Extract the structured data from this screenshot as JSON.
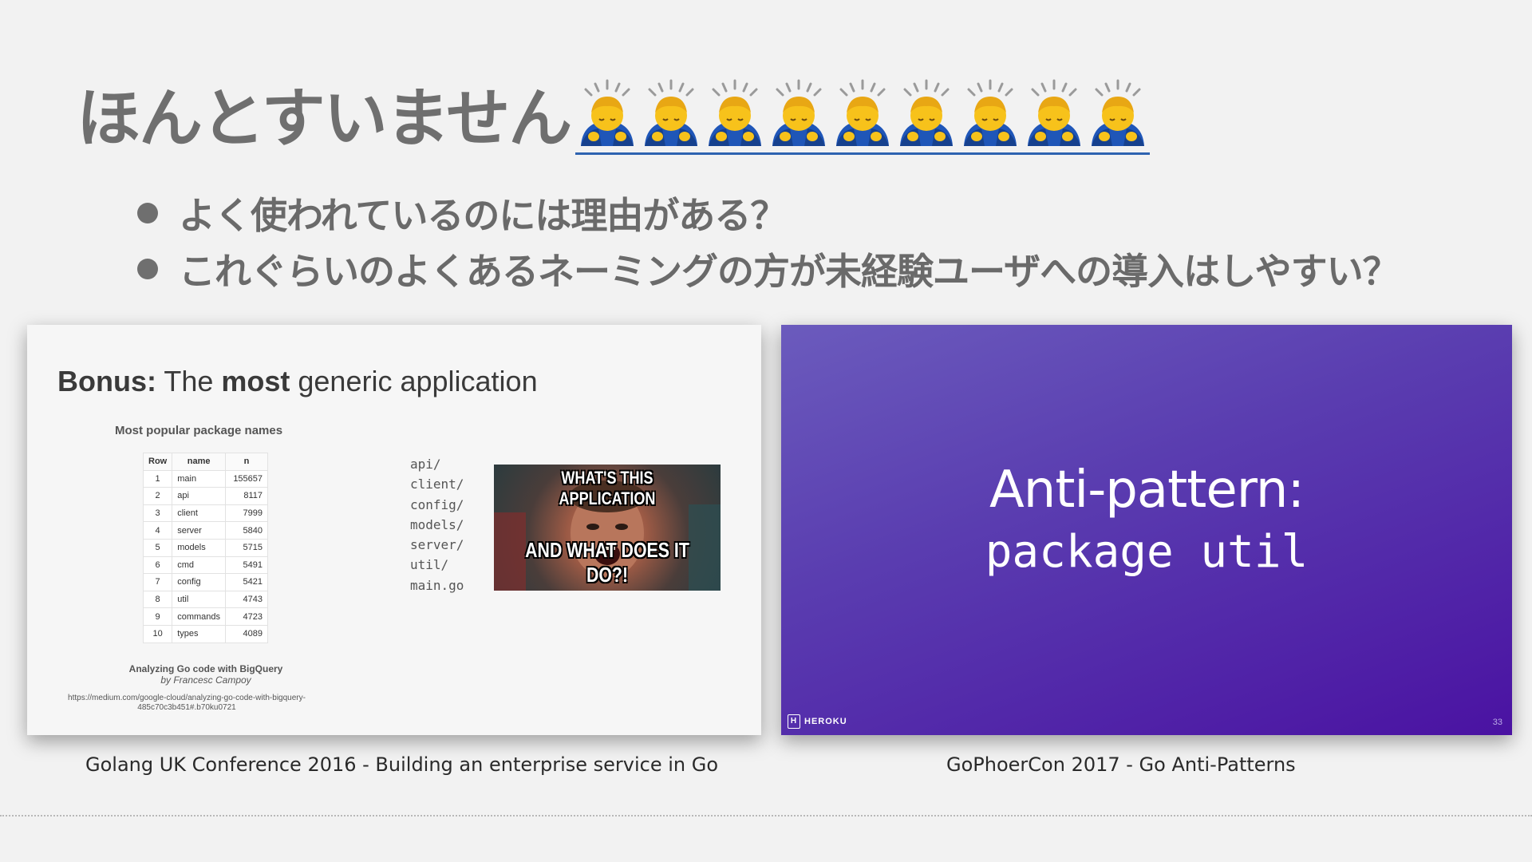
{
  "title": {
    "text": "ほんとすいません",
    "emoji_count": 9,
    "emoji_name": "person-bowing"
  },
  "bullets": [
    "よく使われているのには理由がある？",
    "これぐらいのよくあるネーミングの方が未経験ユーザへの導入はしやすい？"
  ],
  "left_slide": {
    "title_bold1": "Bonus:",
    "title_mid1": " The ",
    "title_bold2": "most",
    "title_mid2": " generic application",
    "subtitle": "Most popular package names",
    "table": {
      "headers": [
        "Row",
        "name",
        "n"
      ],
      "rows": [
        [
          "1",
          "main",
          "155657"
        ],
        [
          "2",
          "api",
          "8117"
        ],
        [
          "3",
          "client",
          "7999"
        ],
        [
          "4",
          "server",
          "5840"
        ],
        [
          "5",
          "models",
          "5715"
        ],
        [
          "6",
          "cmd",
          "5491"
        ],
        [
          "7",
          "config",
          "5421"
        ],
        [
          "8",
          "util",
          "4743"
        ],
        [
          "9",
          "commands",
          "4723"
        ],
        [
          "10",
          "types",
          "4089"
        ]
      ]
    },
    "caption_title": "Analyzing Go code with BigQuery",
    "caption_author": "by Francesc Campoy",
    "url": "https://medium.com/google-cloud/analyzing-go-code-with-bigquery-485c70c3b451#.b70ku0721",
    "dirs": [
      "api/",
      "client/",
      "config/",
      "models/",
      "server/",
      "util/",
      "main.go"
    ],
    "meme_top": "WHAT'S THIS APPLICATION",
    "meme_bottom": "AND WHAT DOES IT DO?!"
  },
  "right_slide": {
    "title": "Anti-pattern:",
    "subtitle": "package util",
    "brand": "HEROKU",
    "page_number": "33"
  },
  "captions": {
    "left": "Golang UK Conference 2016 - Building an enterprise service in Go",
    "right": "GoPhoerCon 2017 -  Go Anti-Patterns"
  }
}
